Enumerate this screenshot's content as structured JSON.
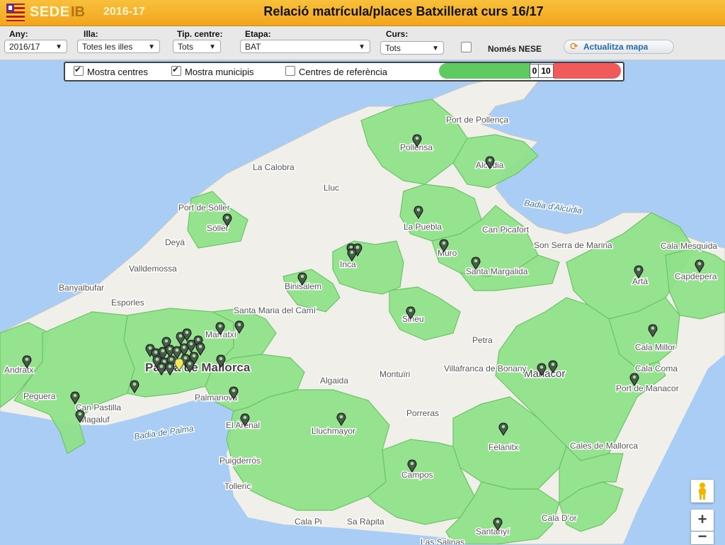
{
  "header": {
    "logo_sede": "SEDE",
    "logo_ib": "IB",
    "logo_year": "2016-17",
    "title": "Relació matrícula/places Batxillerat curs 16/17"
  },
  "filters": {
    "any": {
      "label": "Any:",
      "value": "2016/17"
    },
    "illa": {
      "label": "Illa:",
      "value": "Totes les illes"
    },
    "tip_centre": {
      "label": "Tip. centre:",
      "value": "Tots"
    },
    "etapa": {
      "label": "Etapa:",
      "value": "BAT"
    },
    "curs": {
      "label": "Curs:",
      "value": "Tots"
    },
    "nese_label": "Només NESE",
    "nese_checked": false,
    "update_label": "Actualitza mapa"
  },
  "map_controls": {
    "mostra_centres": {
      "label": "Mostra centres",
      "checked": true
    },
    "mostra_municipis": {
      "label": "Mostra municipis",
      "checked": true
    },
    "centres_referencia": {
      "label": "Centres de referència",
      "checked": false
    },
    "range_min": "0",
    "range_max": "10",
    "range_low_color": "#5fca5f",
    "range_high_color": "#f05a5a"
  },
  "map": {
    "sea_color": "#a9cdf4",
    "land_color": "#f0efe9",
    "region_color": "#8fe08a",
    "region_border": "#6cc466",
    "labels": [
      "Port de Pollença",
      "Pollensa",
      "Alcúdia",
      "La Calobra",
      "Lluc",
      "Port de Sóller",
      "Badia d'Alcúdia",
      "Sóller",
      "La Puebla",
      "Can Picafort",
      "Deyá",
      "Son Serra de Marina",
      "Muro",
      "Cala Mesquida",
      "Inca",
      "Valldemossa",
      "Santa Margalida",
      "Artá",
      "Capdepera",
      "Banyalbufar",
      "Binisalem",
      "Esporles",
      "Santa Maria del Camí",
      "Sineu",
      "Marratxí",
      "Petra",
      "Cala Millor",
      "Andratx",
      "Palma de Mallorca",
      "Montuïri",
      "Manacor",
      "Villafranca de Bonany",
      "Cala Coma",
      "Algaida",
      "Port de Manacor",
      "Peguera",
      "Palmanova",
      "Can Pastilla",
      "Magaluf",
      "Porreras",
      "El Arenal",
      "Badia de Palma",
      "Lluchmayor",
      "Felanitx",
      "Cales de Mallorca",
      "Puigderrós",
      "Campos",
      "Tolleric",
      "Cala Pi",
      "Sa Ràpita",
      "Santanyí",
      "Cala D'or",
      "Las Salinas"
    ]
  },
  "zoom": {
    "plus": "+",
    "minus": "−"
  }
}
